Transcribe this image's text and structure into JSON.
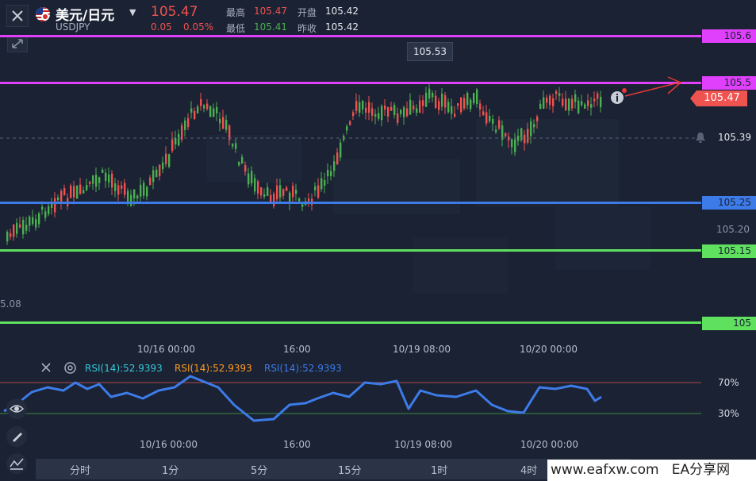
{
  "header": {
    "title": "美元/日元",
    "symbol": "USDJPY",
    "price": "105.47",
    "change": "0.05",
    "change_pct": "0.05%",
    "high_label": "最高",
    "high": "105.47",
    "open_label": "开盘",
    "open": "105.42",
    "low_label": "最低",
    "low": "105.41",
    "prev_label": "昨收",
    "prev_close": "105.42"
  },
  "chart": {
    "tooltip": "105.53",
    "current_price": "105.47",
    "alert_price": "105.39",
    "axis_tick": "105.20",
    "left_edge_label": "5.08",
    "levels": [
      {
        "label": "105.6",
        "color": "#e040fb"
      },
      {
        "label": "105.5",
        "color": "#e040fb"
      },
      {
        "label": "105.25",
        "color": "#3d7be8"
      },
      {
        "label": "105.15",
        "color": "#5fe05f"
      },
      {
        "label": "105",
        "color": "#5fe05f"
      }
    ],
    "x_labels": [
      "10/16 00:00",
      "16:00",
      "10/19 08:00",
      "10/20 00:00"
    ],
    "up_color": "#ef5350",
    "down_color": "#4caf50"
  },
  "rsi": {
    "labels": [
      "RSI(14):52.9393",
      "RSI(14):52.9393",
      "RSI(14):52.9393"
    ],
    "label_colors": [
      "#33c9d8",
      "#ff9a1f",
      "#3d7be8"
    ],
    "upper_label": "70%",
    "lower_label": "30%",
    "x_labels": [
      "10/16 00:00",
      "16:00",
      "10/19 08:00",
      "10/20 00:00"
    ],
    "line_color": "#3d7be8"
  },
  "timeframes": [
    "分时",
    "1分",
    "5分",
    "15分",
    "1时",
    "4时"
  ],
  "watermark": "www.eafxw.com   EA分享网",
  "icons": [
    "close-icon",
    "us-flag-icon",
    "chevron-down-icon",
    "expand-icon",
    "info-icon",
    "bell-icon",
    "eye-icon",
    "draw-icon",
    "indicator-icon"
  ]
}
